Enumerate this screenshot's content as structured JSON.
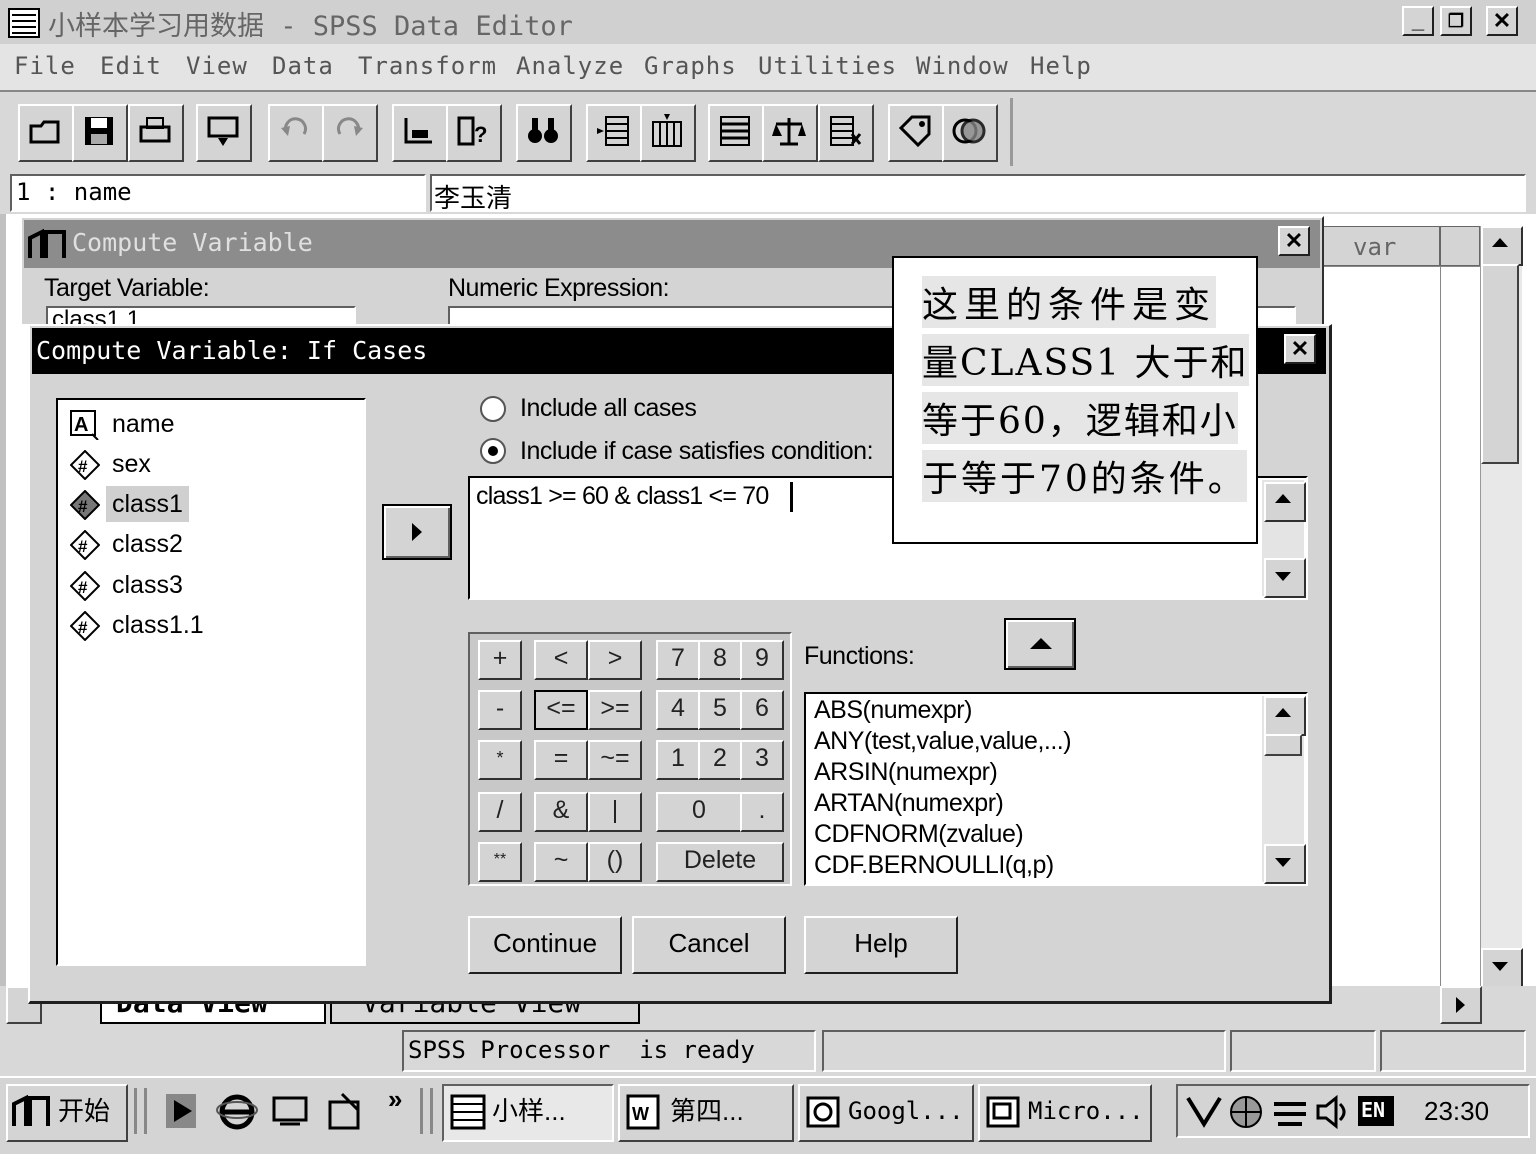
{
  "window": {
    "title": "小样本学习用数据 - SPSS Data Editor",
    "minimize": "_",
    "restore": "❐",
    "close": "✕"
  },
  "menu": [
    "File",
    "Edit",
    "View",
    "Data",
    "Transform",
    "Analyze",
    "Graphs",
    "Utilities",
    "Window",
    "Help"
  ],
  "cell_editor": {
    "ref": "1 : name",
    "value": "李玉清"
  },
  "grid": {
    "column_header": "var"
  },
  "data_tabs": {
    "data_view": "Data View",
    "variable_view": "Variable View"
  },
  "status": {
    "text": "SPSS Processor  is ready"
  },
  "compute_dialog": {
    "title": "Compute Variable",
    "target_label": "Target Variable:",
    "target_value": "class1.1",
    "expression_label": "Numeric Expression:",
    "close": "✕"
  },
  "if_dialog": {
    "title": "Compute Variable: If Cases",
    "close": "✕",
    "variables": [
      {
        "name": "name",
        "type": "string"
      },
      {
        "name": "sex",
        "type": "numeric"
      },
      {
        "name": "class1",
        "type": "numeric",
        "selected": true
      },
      {
        "name": "class2",
        "type": "numeric"
      },
      {
        "name": "class3",
        "type": "numeric"
      },
      {
        "name": "class1.1",
        "type": "numeric"
      }
    ],
    "radio_all": "Include all cases",
    "radio_if": "Include if case satisfies condition:",
    "selected_radio": "if",
    "condition": "class1 >= 60 & class1 <= 70",
    "functions_label": "Functions:",
    "functions": [
      "ABS(numexpr)",
      "ANY(test,value,value,...)",
      "ARSIN(numexpr)",
      "ARTAN(numexpr)",
      "CDFNORM(zvalue)",
      "CDF.BERNOULLI(q,p)"
    ],
    "keypad": {
      "plus": "+",
      "lt": "<",
      "gt": ">",
      "k7": "7",
      "k8": "8",
      "k9": "9",
      "minus": "-",
      "le": "<=",
      "ge": ">=",
      "k4": "4",
      "k5": "5",
      "k6": "6",
      "times": "*",
      "eq": "=",
      "ne": "~=",
      "k1": "1",
      "k2": "2",
      "k3": "3",
      "div": "/",
      "and": "&",
      "or": "|",
      "k0": "0",
      "dot": ".",
      "pow": "**",
      "not": "~",
      "paren": "()",
      "delete": "Delete"
    },
    "buttons": {
      "continue": "Continue",
      "cancel": "Cancel",
      "help": "Help"
    }
  },
  "annotation": {
    "line1": "这里的条件是变",
    "line2": "量CLASS1 大于和",
    "line3": "等于60，逻辑和小",
    "line4": "于等于70的条件。"
  },
  "taskbar": {
    "start": "开始",
    "chevron": "»",
    "tasks": [
      "小样...",
      "第四...",
      "Googl...",
      "Micro..."
    ],
    "lang": "EN",
    "clock": "23:30"
  }
}
